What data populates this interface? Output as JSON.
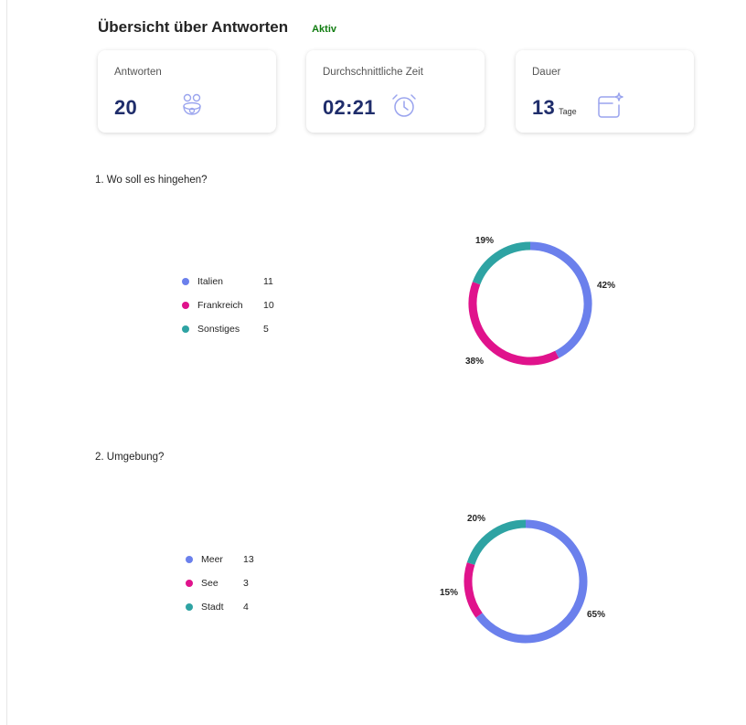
{
  "header": {
    "title": "Übersicht über Antworten",
    "status": "Aktiv"
  },
  "summary_cards": [
    {
      "label": "Antworten",
      "value": "20",
      "unit": "",
      "icon": "people-icon"
    },
    {
      "label": "Durchschnittliche Zeit",
      "value": "02:21",
      "unit": "",
      "icon": "alarm-clock-icon"
    },
    {
      "label": "Dauer",
      "value": "13",
      "unit": "Tage",
      "icon": "calendar-sparkle-icon"
    }
  ],
  "colors": {
    "blue": "#6b80ec",
    "magenta": "#e0138c",
    "teal": "#2ea3a3",
    "accent_text": "#1f2d6b",
    "status": "#107c10"
  },
  "questions": [
    {
      "title": "1. Wo soll es hingehen?",
      "options": [
        {
          "label": "Italien",
          "count": "11",
          "color": "#6b80ec",
          "percent": "42%"
        },
        {
          "label": "Frankreich",
          "count": "10",
          "color": "#e0138c",
          "percent": "38%"
        },
        {
          "label": "Sonstiges",
          "count": "5",
          "color": "#2ea3a3",
          "percent": "19%"
        }
      ]
    },
    {
      "title": "2. Umgebung?",
      "options": [
        {
          "label": "Meer",
          "count": "13",
          "color": "#6b80ec",
          "percent": "65%"
        },
        {
          "label": "See",
          "count": "3",
          "color": "#e0138c",
          "percent": "15%"
        },
        {
          "label": "Stadt",
          "count": "4",
          "color": "#2ea3a3",
          "percent": "20%"
        }
      ]
    }
  ],
  "chart_data": [
    {
      "type": "pie",
      "title": "1. Wo soll es hingehen?",
      "categories": [
        "Italien",
        "Frankreich",
        "Sonstiges"
      ],
      "values": [
        11,
        10,
        5
      ],
      "percent_labels": [
        "42%",
        "38%",
        "19%"
      ]
    },
    {
      "type": "pie",
      "title": "2. Umgebung?",
      "categories": [
        "Meer",
        "See",
        "Stadt"
      ],
      "values": [
        13,
        3,
        4
      ],
      "percent_labels": [
        "65%",
        "15%",
        "20%"
      ]
    }
  ]
}
